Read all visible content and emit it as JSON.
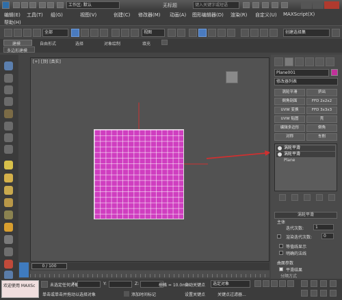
{
  "titlebar": {
    "workspace": "工作区: 默认",
    "doc_title": "无标题",
    "search_placeholder": "键入关键字或短语"
  },
  "menu": [
    "编辑(E)",
    "工具(T)",
    "组(G)",
    "视图(V)",
    "创建(C)",
    "修改器(M)",
    "动画(A)",
    "图形编辑器(D)",
    "渲染(R)",
    "自定义(U)",
    "MAXScript(X)",
    "帮助(H)"
  ],
  "toolbar": {
    "selection_filter": "全部",
    "ref_coord": "视图",
    "named_selection": "创建选择集"
  },
  "ribbon": {
    "tabs": [
      "建模",
      "自由形式",
      "选择",
      "对象绘制",
      "填充"
    ],
    "sub_label": "多边形建模"
  },
  "viewport": {
    "label": "[+] [顶] [真实]",
    "plane_color": "#cf3ec0"
  },
  "command_panel": {
    "object_name": "Plane001",
    "object_color": "#c2309a",
    "modifier_list": "修改器列表",
    "buttons": [
      "涡轮平滑",
      "挤出",
      "倒角剖面",
      "FFD 2x2x2",
      "UVW 变换",
      "FFD 3x3x3",
      "UVW 贴图",
      "壳",
      "编辑多边形",
      "倒角",
      "对称",
      "车削"
    ],
    "stack": [
      "涡轮平滑",
      "涡轮平滑",
      "Plane"
    ],
    "rollout_title": "涡轮平滑",
    "main_label": "主体",
    "iterations_label": "迭代次数:",
    "iterations_value": "1",
    "render_iter_label": "渲染迭代次数:",
    "render_iter_value": "0",
    "isoline_label": "等值线显示",
    "explicit_normals_label": "明确的法线",
    "surface_params_label": "曲面参数",
    "smooth_result_label": "平滑结果",
    "separate_label": "分隔方式"
  },
  "timeline": {
    "frame": "0 / 100"
  },
  "status": {
    "welcome": "欢迎使用 MAXSc",
    "selected": "未选定任何对象",
    "prompt": "单击或单击并拖动以选择对象",
    "x_label": "X:",
    "y_label": "Y:",
    "z_label": "Z:",
    "grid": "栅格 = 10.0mm",
    "auto_key": "自动关键点",
    "selected_obj": "选定对象",
    "set_key": "设置关键点",
    "key_filter": "关键点过滤器...",
    "add_time_tag": "添加时间标记"
  }
}
